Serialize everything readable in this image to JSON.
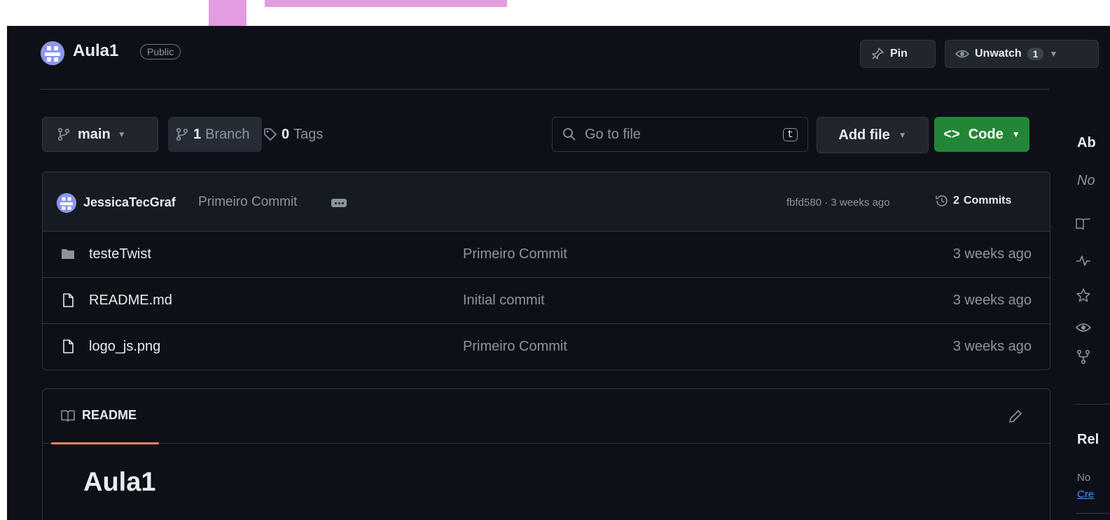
{
  "repo": {
    "name": "Aula1",
    "visibility": "Public",
    "pin_label": "Pin",
    "unwatch_label": "Unwatch",
    "watch_count": "1"
  },
  "toolbar": {
    "branch_name": "main",
    "branch_count": "1",
    "branch_label": "Branch",
    "tag_count": "0",
    "tag_label": "Tags",
    "search_placeholder": "Go to file",
    "search_shortcut": "t",
    "add_file_label": "Add file",
    "code_label": "Code"
  },
  "latest_commit": {
    "author": "JessicaTecGraf",
    "message": "Primeiro Commit",
    "meta": "fbfd580 · 3 weeks ago",
    "commits_count": "2",
    "commits_label": "Commits"
  },
  "files": [
    {
      "name": "testeTwist",
      "type": "folder",
      "commit": "Primeiro Commit",
      "time": "3 weeks ago"
    },
    {
      "name": "README.md",
      "type": "file",
      "commit": "Initial commit",
      "time": "3 weeks ago"
    },
    {
      "name": "logo_js.png",
      "type": "file",
      "commit": "Primeiro Commit",
      "time": "3 weeks ago"
    }
  ],
  "readme": {
    "tab_label": "README",
    "title": "Aula1"
  },
  "sidebar": {
    "about_heading": "Ab",
    "about_desc": "No",
    "releases_heading": "Rel",
    "releases_text": "No",
    "releases_link": "Cre"
  },
  "colors": {
    "background": "#0d1117",
    "border": "#30363d",
    "code_button": "#238636",
    "readme_underline": "#f78166",
    "annotation": "#e29ce0",
    "link": "#4493f8"
  },
  "icons": {
    "repo_avatar": "avatar-icon",
    "pin": "pin-icon",
    "eye": "eye-icon",
    "branch": "git-branch-icon",
    "tag": "tag-icon",
    "search": "search-icon",
    "code": "code-icon",
    "history": "history-icon",
    "folder": "folder-icon",
    "file": "file-icon",
    "book": "book-icon",
    "pencil": "pencil-icon"
  }
}
